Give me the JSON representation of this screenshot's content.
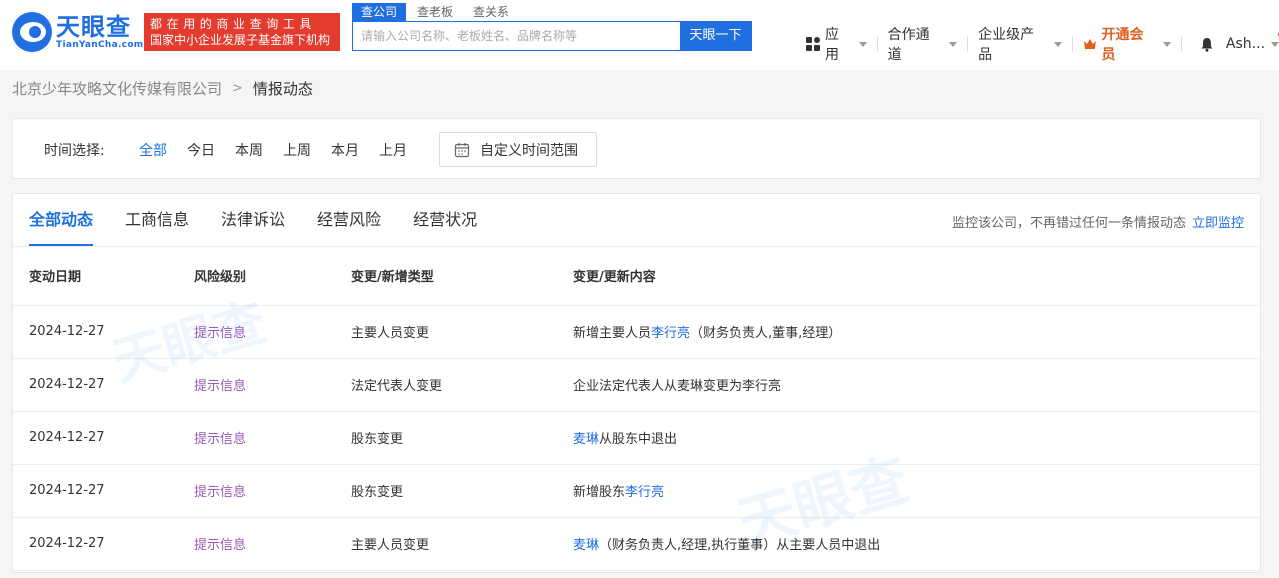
{
  "header": {
    "logo_cn": "天眼查",
    "logo_en": "TianYanCha.com",
    "slogan_line1": "都在用的商业查询工具",
    "slogan_line2": "国家中小企业发展子基金旗下机构",
    "search_tabs": [
      "查公司",
      "查老板",
      "查关系"
    ],
    "search_placeholder": "请输入公司名称、老板姓名、品牌名称等",
    "search_button": "天眼一下",
    "nav": {
      "apps": "应用",
      "channel": "合作通道",
      "enterprise": "企业级产品",
      "vip": "开通会员",
      "user": "Ash..."
    }
  },
  "breadcrumb": {
    "company": "北京少年攻略文化传媒有限公司",
    "current": "情报动态"
  },
  "time_filter": {
    "label": "时间选择:",
    "options": [
      "全部",
      "今日",
      "本周",
      "上周",
      "本月",
      "上月"
    ],
    "custom": "自定义时间范围"
  },
  "tabs": [
    "全部动态",
    "工商信息",
    "法律诉讼",
    "经营风险",
    "经营状况"
  ],
  "monitor": {
    "text": "监控该公司，不再错过任何一条情报动态",
    "link": "立即监控"
  },
  "table": {
    "headers": [
      "变动日期",
      "风险级别",
      "变更/新增类型",
      "变更/更新内容"
    ],
    "rows": [
      {
        "date": "2024-12-27",
        "risk": "提示信息",
        "type": "主要人员变更",
        "pre": "新增主要人员",
        "link": "李行亮",
        "post": "（财务负责人,董事,经理）"
      },
      {
        "date": "2024-12-27",
        "risk": "提示信息",
        "type": "法定代表人变更",
        "pre": "企业法定代表人从麦琳变更为李行亮",
        "link": "",
        "post": ""
      },
      {
        "date": "2024-12-27",
        "risk": "提示信息",
        "type": "股东变更",
        "pre": "",
        "link": "麦琳",
        "post": "从股东中退出"
      },
      {
        "date": "2024-12-27",
        "risk": "提示信息",
        "type": "股东变更",
        "pre": "新增股东",
        "link": "李行亮",
        "post": ""
      },
      {
        "date": "2024-12-27",
        "risk": "提示信息",
        "type": "主要人员变更",
        "pre": "",
        "link": "麦琳",
        "post": "（财务负责人,经理,执行董事）从主要人员中退出"
      }
    ]
  },
  "colors": {
    "brand": "#1f6fe0",
    "slogan_bg": "#e33b2e",
    "risk": "#9b59b6",
    "vip": "#e0601e"
  }
}
